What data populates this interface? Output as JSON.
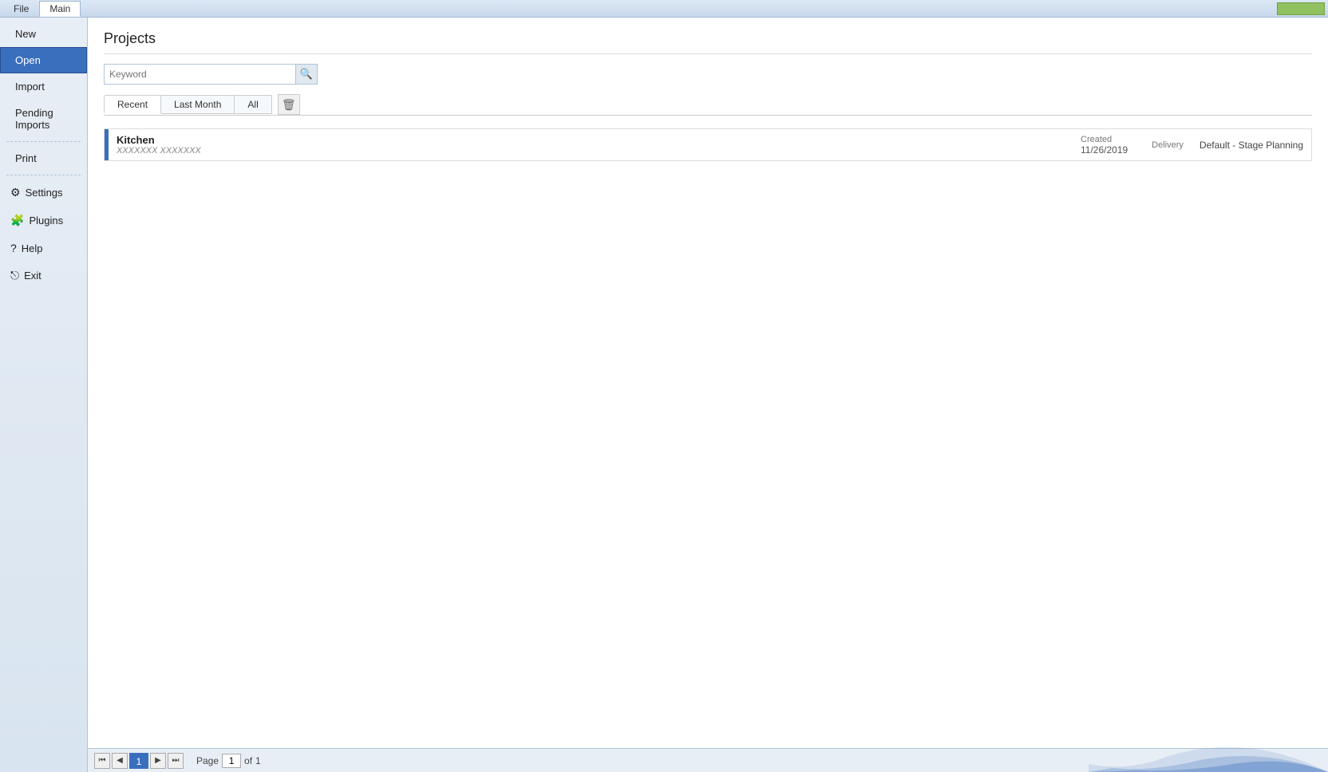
{
  "titlebar": {
    "tabs": [
      {
        "label": "File",
        "active": false
      },
      {
        "label": "Main",
        "active": false
      }
    ],
    "controls": {
      "btn_label": ""
    }
  },
  "sidebar": {
    "items": [
      {
        "id": "new",
        "label": "New",
        "icon": "",
        "active": false
      },
      {
        "id": "open",
        "label": "Open",
        "icon": "",
        "active": true
      },
      {
        "id": "import",
        "label": "Import",
        "icon": "",
        "active": false
      },
      {
        "id": "pending-imports",
        "label": "Pending Imports",
        "icon": "",
        "active": false
      },
      {
        "id": "print",
        "label": "Print",
        "icon": "",
        "active": false
      },
      {
        "id": "settings",
        "label": "Settings",
        "icon": "⚙",
        "active": false
      },
      {
        "id": "plugins",
        "label": "Plugins",
        "icon": "🧩",
        "active": false
      },
      {
        "id": "help",
        "label": "Help",
        "icon": "?",
        "active": false
      },
      {
        "id": "exit",
        "label": "Exit",
        "icon": "⎋",
        "active": false
      }
    ]
  },
  "content": {
    "page_title": "Projects",
    "search": {
      "placeholder": "Keyword",
      "value": ""
    },
    "filter_tabs": [
      {
        "label": "Recent",
        "active": true
      },
      {
        "label": "Last Month",
        "active": false
      },
      {
        "label": "All",
        "active": false
      }
    ],
    "projects": [
      {
        "name": "Kitchen",
        "id": "XXXXXXX XXXXXXX",
        "created_label": "Created",
        "created_date": "11/26/2019",
        "delivery_label": "Delivery",
        "stage": "Default - Stage Planning"
      }
    ]
  },
  "footer": {
    "page_label": "Page",
    "page_current": "1",
    "page_of": "of",
    "page_total": "1"
  },
  "icons": {
    "search": "🔍",
    "trash": "🗑",
    "first": "⏮",
    "prev": "◀",
    "next": "▶",
    "last": "⏭"
  }
}
